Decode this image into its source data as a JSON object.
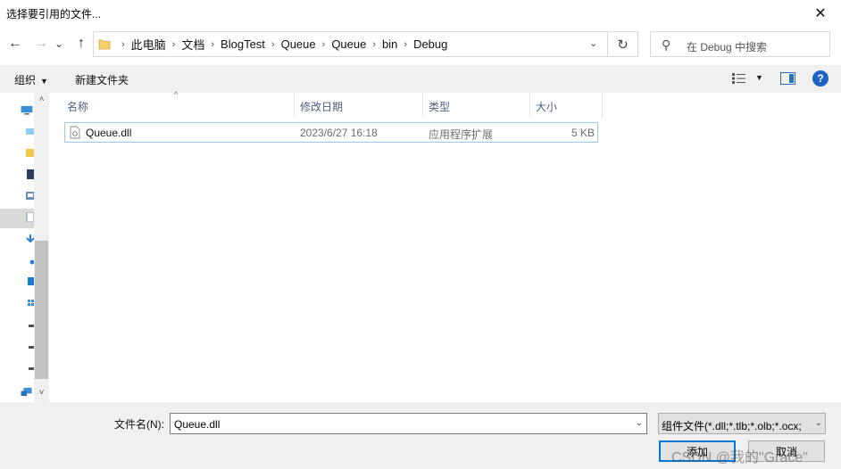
{
  "window": {
    "title": "选择要引用的文件...",
    "close_glyph": "✕"
  },
  "nav": {
    "back_glyph": "←",
    "forward_glyph": "→",
    "recent_glyph": "⌄",
    "up_glyph": "↑",
    "breadcrumbs": [
      "此电脑",
      "文档",
      "BlogTest",
      "Queue",
      "Queue",
      "bin",
      "Debug"
    ],
    "crumb_separator": "›",
    "dropdown_glyph": "⌄",
    "refresh_glyph": "↻",
    "search_placeholder": "在 Debug 中搜索",
    "search_glyph": "⚲"
  },
  "toolbar": {
    "organize_label": "组织",
    "organize_arrow": "▼",
    "new_folder_label": "新建文件夹",
    "view_arrow": "▼",
    "help_glyph": "?"
  },
  "filelist": {
    "sort_glyph": "^",
    "columns": {
      "name": "名称",
      "date": "修改日期",
      "type": "类型",
      "size": "大小"
    },
    "rows": [
      {
        "name": "Queue.dll",
        "date": "2023/6/27 16:18",
        "type": "应用程序扩展",
        "size": "5 KB"
      }
    ]
  },
  "scrollbar": {
    "up_glyph": "˄",
    "down_glyph": "˅"
  },
  "bottom": {
    "filename_label": "文件名(N):",
    "filename_value": "Queue.dll",
    "filename_drop": "⌄",
    "filetype_value": "组件文件(*.dll;*.tlb;*.olb;*.ocx;",
    "filetype_drop": "⌄",
    "open_label": "添加",
    "cancel_label": "取消",
    "watermark": "CSDN @我的\"Grace\""
  },
  "colors": {
    "accent": "#0078d7",
    "selection_border": "#99c9ef",
    "header_text": "#4c607a"
  }
}
